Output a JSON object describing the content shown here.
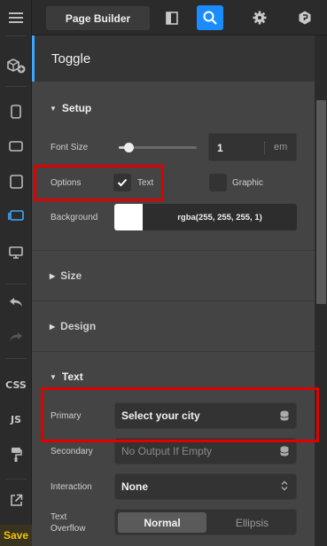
{
  "toolbar": {
    "page_builder_label": "Page Builder",
    "icons": [
      "panel-toggle-icon",
      "search-icon",
      "gear-icon",
      "plugin-icon"
    ]
  },
  "rail": {
    "css_label": "CSS",
    "js_label": "JS",
    "save_label": "Save"
  },
  "panel": {
    "title": "Toggle",
    "setup": {
      "heading": "Setup",
      "font_size_label": "Font Size",
      "font_size_value": "1",
      "font_size_unit": "em",
      "font_size_slider_fraction": 0.12,
      "options_label": "Options",
      "option_text_label": "Text",
      "option_text_checked": true,
      "option_graphic_label": "Graphic",
      "option_graphic_checked": false,
      "background_label": "Background",
      "background_value": "rgba(255, 255, 255, 1)",
      "background_color": "#ffffff"
    },
    "size_heading": "Size",
    "design_heading": "Design",
    "text": {
      "heading": "Text",
      "primary_label": "Primary",
      "primary_value": "Select your city",
      "secondary_label": "Secondary",
      "secondary_placeholder": "No Output If Empty",
      "interaction_label": "Interaction",
      "interaction_value": "None",
      "overflow_label_line1": "Text",
      "overflow_label_line2": "Overflow",
      "overflow_options": [
        "Normal",
        "Ellipsis"
      ],
      "overflow_selected": "Normal"
    }
  },
  "colors": {
    "accent": "#1a8cff",
    "highlight": "#e00000",
    "save": "#f5c400"
  }
}
